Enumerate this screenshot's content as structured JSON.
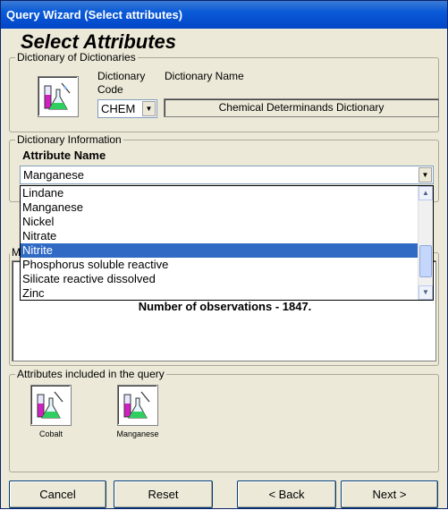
{
  "window": {
    "title": "Query Wizard (Select attributes)"
  },
  "page": {
    "heading": "Select Attributes"
  },
  "dictionary_of_dictionaries": {
    "legend": "Dictionary of Dictionaries",
    "code_label": "Dictionary Code",
    "name_label": "Dictionary Name",
    "code_value": "CHEM",
    "name_value": "Chemical Determinands Dictionary"
  },
  "dictionary_information": {
    "legend": "Dictionary Information",
    "attribute_label": "Attribute Name",
    "attribute_value": "Manganese",
    "options": [
      "Lindane",
      "Manganese",
      "Nickel",
      "Nitrate",
      "Nitrite",
      "Phosphorus soluble reactive",
      "Silicate reactive dissolved",
      "Zinc"
    ],
    "highlighted": "Nitrite",
    "partial_legend": "M"
  },
  "observations": {
    "text": "Number of observations - 1847."
  },
  "included": {
    "legend": "Attributes included in the query",
    "items": [
      {
        "label": "Cobalt"
      },
      {
        "label": "Manganese"
      }
    ]
  },
  "buttons": {
    "cancel": "Cancel",
    "reset": "Reset",
    "back": "< Back",
    "next": "Next >"
  },
  "icons": {
    "chemistry": "chemistry-flasks-icon",
    "dropdown": "chevron-down-icon",
    "scroll_up": "scroll-up-icon",
    "scroll_down": "scroll-down-icon"
  },
  "colors": {
    "titlebar": "#0a5ad7",
    "selection": "#316ac5",
    "dialog_bg": "#ece9d8"
  }
}
